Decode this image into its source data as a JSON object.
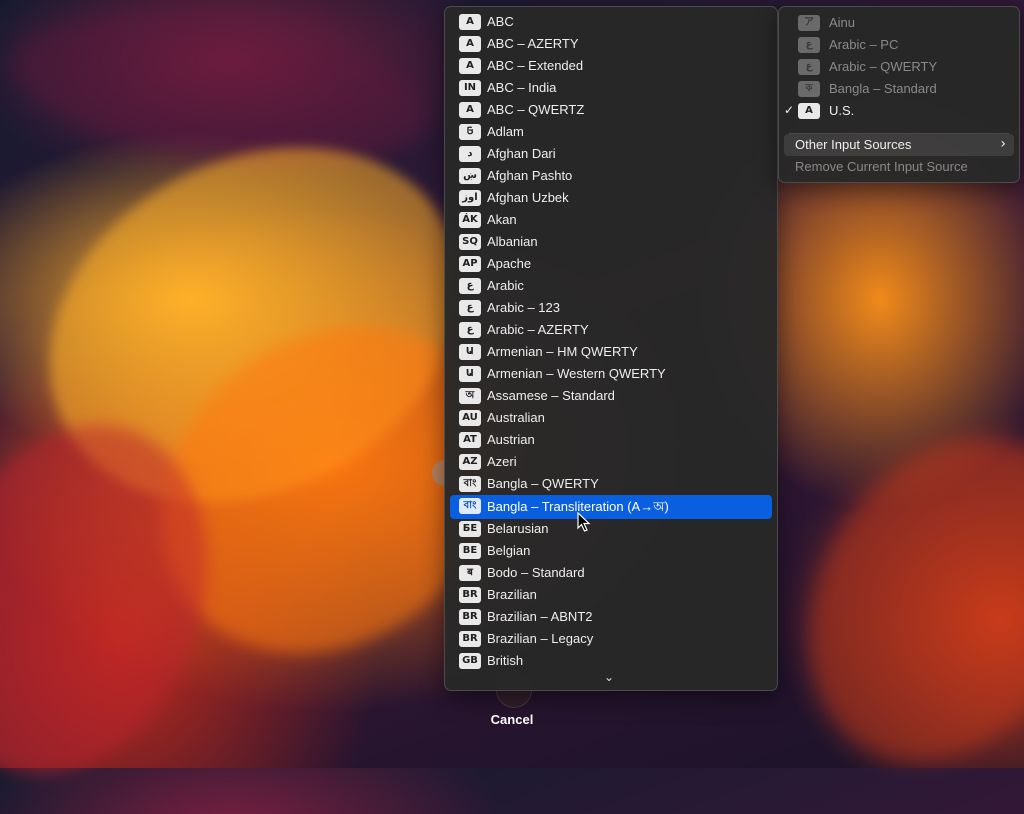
{
  "input_list": {
    "items": [
      {
        "flag": "A",
        "label": "ABC"
      },
      {
        "flag": "A",
        "label": "ABC – AZERTY"
      },
      {
        "flag": "A",
        "label": "ABC – Extended"
      },
      {
        "flag": "IN",
        "label": "ABC – India"
      },
      {
        "flag": "A",
        "label": "ABC – QWERTZ"
      },
      {
        "flag": "𞤀",
        "label": "Adlam"
      },
      {
        "flag": "د",
        "label": "Afghan Dari"
      },
      {
        "flag": "ښ",
        "label": "Afghan Pashto"
      },
      {
        "flag": "اوز",
        "label": "Afghan Uzbek"
      },
      {
        "flag": "ÁK",
        "label": "Akan"
      },
      {
        "flag": "SQ",
        "label": "Albanian"
      },
      {
        "flag": "AP",
        "label": "Apache"
      },
      {
        "flag": "ع",
        "label": "Arabic"
      },
      {
        "flag": "ع",
        "label": "Arabic – 123"
      },
      {
        "flag": "ع",
        "label": "Arabic – AZERTY"
      },
      {
        "flag": "Ա",
        "label": "Armenian – HM QWERTY"
      },
      {
        "flag": "Ա",
        "label": "Armenian – Western QWERTY"
      },
      {
        "flag": "অ",
        "label": "Assamese – Standard"
      },
      {
        "flag": "AU",
        "label": "Australian"
      },
      {
        "flag": "AT",
        "label": "Austrian"
      },
      {
        "flag": "AZ",
        "label": "Azeri"
      },
      {
        "flag": "বাং",
        "label": "Bangla – QWERTY"
      },
      {
        "flag": "বাং",
        "label": "Bangla – Transliteration (A→অ)",
        "selected": true
      },
      {
        "flag": "БЕ",
        "label": "Belarusian"
      },
      {
        "flag": "BE",
        "label": "Belgian"
      },
      {
        "flag": "ब",
        "label": "Bodo – Standard"
      },
      {
        "flag": "BR",
        "label": "Brazilian"
      },
      {
        "flag": "BR",
        "label": "Brazilian – ABNT2"
      },
      {
        "flag": "BR",
        "label": "Brazilian – Legacy"
      },
      {
        "flag": "GB",
        "label": "British"
      }
    ],
    "scroll_indicator": "⌄"
  },
  "input_menu": {
    "sources": [
      {
        "flag": "ア",
        "label": "Ainu",
        "disabled": true
      },
      {
        "flag": "ع",
        "label": "Arabic – PC",
        "disabled": true
      },
      {
        "flag": "ع",
        "label": "Arabic – QWERTY",
        "disabled": true
      },
      {
        "flag": "ক",
        "label": "Bangla – Standard",
        "disabled": true
      },
      {
        "flag": "A",
        "label": "U.S.",
        "checked": true,
        "check": "✓"
      }
    ],
    "other_sources_label": "Other Input Sources",
    "other_sources_chevron": "›",
    "remove_label": "Remove Current Input Source"
  },
  "cancel_label": "Cancel",
  "colors": {
    "selection": "#0a5fe0",
    "menu_background": "#282828"
  }
}
